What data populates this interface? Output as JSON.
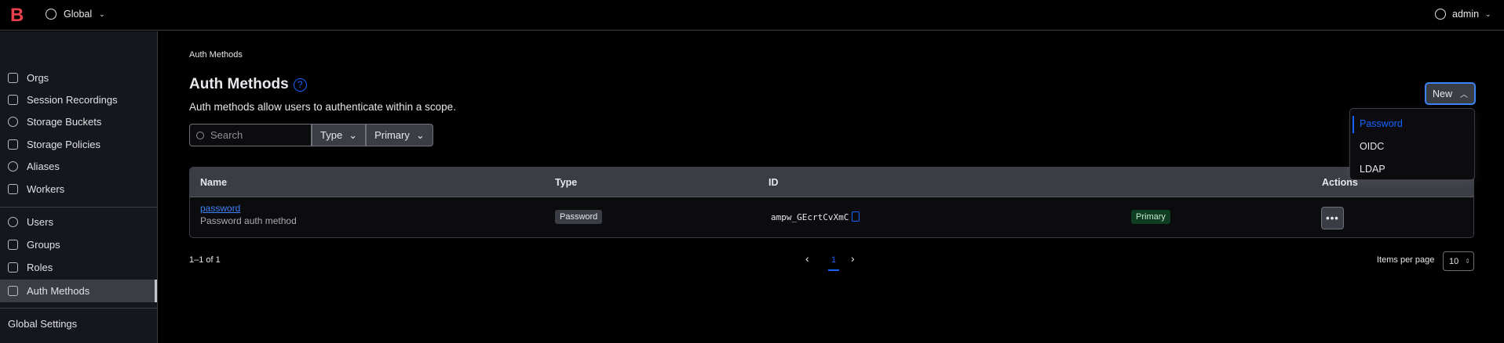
{
  "header": {
    "scope": "Global",
    "user": "admin"
  },
  "sidebar": {
    "items": [
      {
        "label": "Orgs"
      },
      {
        "label": "Session Recordings"
      },
      {
        "label": "Storage Buckets"
      },
      {
        "label": "Storage Policies"
      },
      {
        "label": "Aliases"
      },
      {
        "label": "Workers"
      },
      {
        "label": "Users"
      },
      {
        "label": "Groups"
      },
      {
        "label": "Roles"
      },
      {
        "label": "Auth Methods"
      }
    ],
    "global_settings": "Global Settings"
  },
  "breadcrumb": "Auth Methods",
  "page": {
    "title": "Auth Methods",
    "description": "Auth methods allow users to authenticate within a scope.",
    "new_label": "New"
  },
  "filters": {
    "search_placeholder": "Search",
    "type": "Type",
    "primary": "Primary"
  },
  "new_menu": [
    "Password",
    "OIDC",
    "LDAP"
  ],
  "table": {
    "columns": [
      "Name",
      "Type",
      "ID",
      "Actions"
    ],
    "rows": [
      {
        "name": "password",
        "description": "Password auth method",
        "type": "Password",
        "id": "ampw_GEcrtCvXmC",
        "badge": "Primary"
      }
    ]
  },
  "pagination": {
    "summary": "1–1 of 1",
    "page": "1",
    "items_per_page_label": "Items per page",
    "items_per_page": "10"
  },
  "colors": {
    "accent": "#1563ff",
    "primary_badge": "#0f3d22"
  }
}
